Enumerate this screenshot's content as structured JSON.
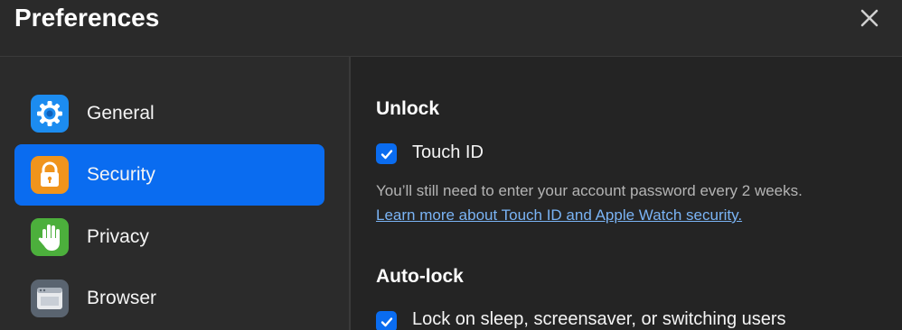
{
  "window": {
    "title": "Preferences"
  },
  "sidebar": {
    "items": [
      {
        "label": "General",
        "icon": "gear-icon",
        "active": false
      },
      {
        "label": "Security",
        "icon": "lock-icon",
        "active": true
      },
      {
        "label": "Privacy",
        "icon": "hand-icon",
        "active": false
      },
      {
        "label": "Browser",
        "icon": "browser-icon",
        "active": false
      }
    ]
  },
  "content": {
    "unlock": {
      "heading": "Unlock",
      "touch_id_label": "Touch ID",
      "touch_id_checked": true,
      "hint": "You’ll still need to enter your account password every 2 weeks.",
      "link": "Learn more about Touch ID and Apple Watch security."
    },
    "autolock": {
      "heading": "Auto-lock",
      "lock_label": "Lock on sleep, screensaver, or switching users",
      "lock_checked": true
    }
  },
  "colors": {
    "accent": "#0a6cf0",
    "link": "#7ab4f5",
    "general_icon_bg": "#1c8cf0",
    "security_icon_bg": "#f0941c",
    "privacy_icon_bg": "#4caf3c",
    "browser_icon_bg": "#5a6470"
  }
}
